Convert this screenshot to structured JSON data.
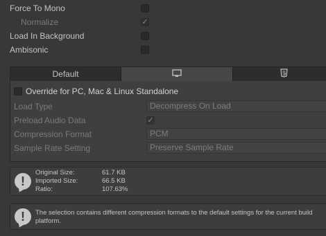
{
  "settings": {
    "force_to_mono": "Force To Mono",
    "normalize": "Normalize",
    "load_in_background": "Load In Background",
    "ambisonic": "Ambisonic",
    "checkmark": "✓"
  },
  "platform_tabs": {
    "default_label": "Default",
    "monitor_icon": "monitor-icon",
    "html5_icon": "html5-icon"
  },
  "override": {
    "label": "Override for PC, Mac & Linux Standalone",
    "load_type_label": "Load Type",
    "load_type_value": "Decompress On Load",
    "preload_label": "Preload Audio Data",
    "compression_label": "Compression Format",
    "compression_value": "PCM",
    "sample_rate_label": "Sample Rate Setting",
    "sample_rate_value": "Preserve Sample Rate"
  },
  "size_info": {
    "original_label": "Original Size:",
    "original_value": "61.7 KB",
    "imported_label": "Imported Size:",
    "imported_value": "66.5 KB",
    "ratio_label": "Ratio:",
    "ratio_value": "107.63%"
  },
  "warning": {
    "message": "The selection contains different compression formats to the default settings for the current build platform."
  },
  "colors": {
    "background": "#383838",
    "text": "#c4c4c4",
    "disabled_text": "#7a7a7a"
  }
}
